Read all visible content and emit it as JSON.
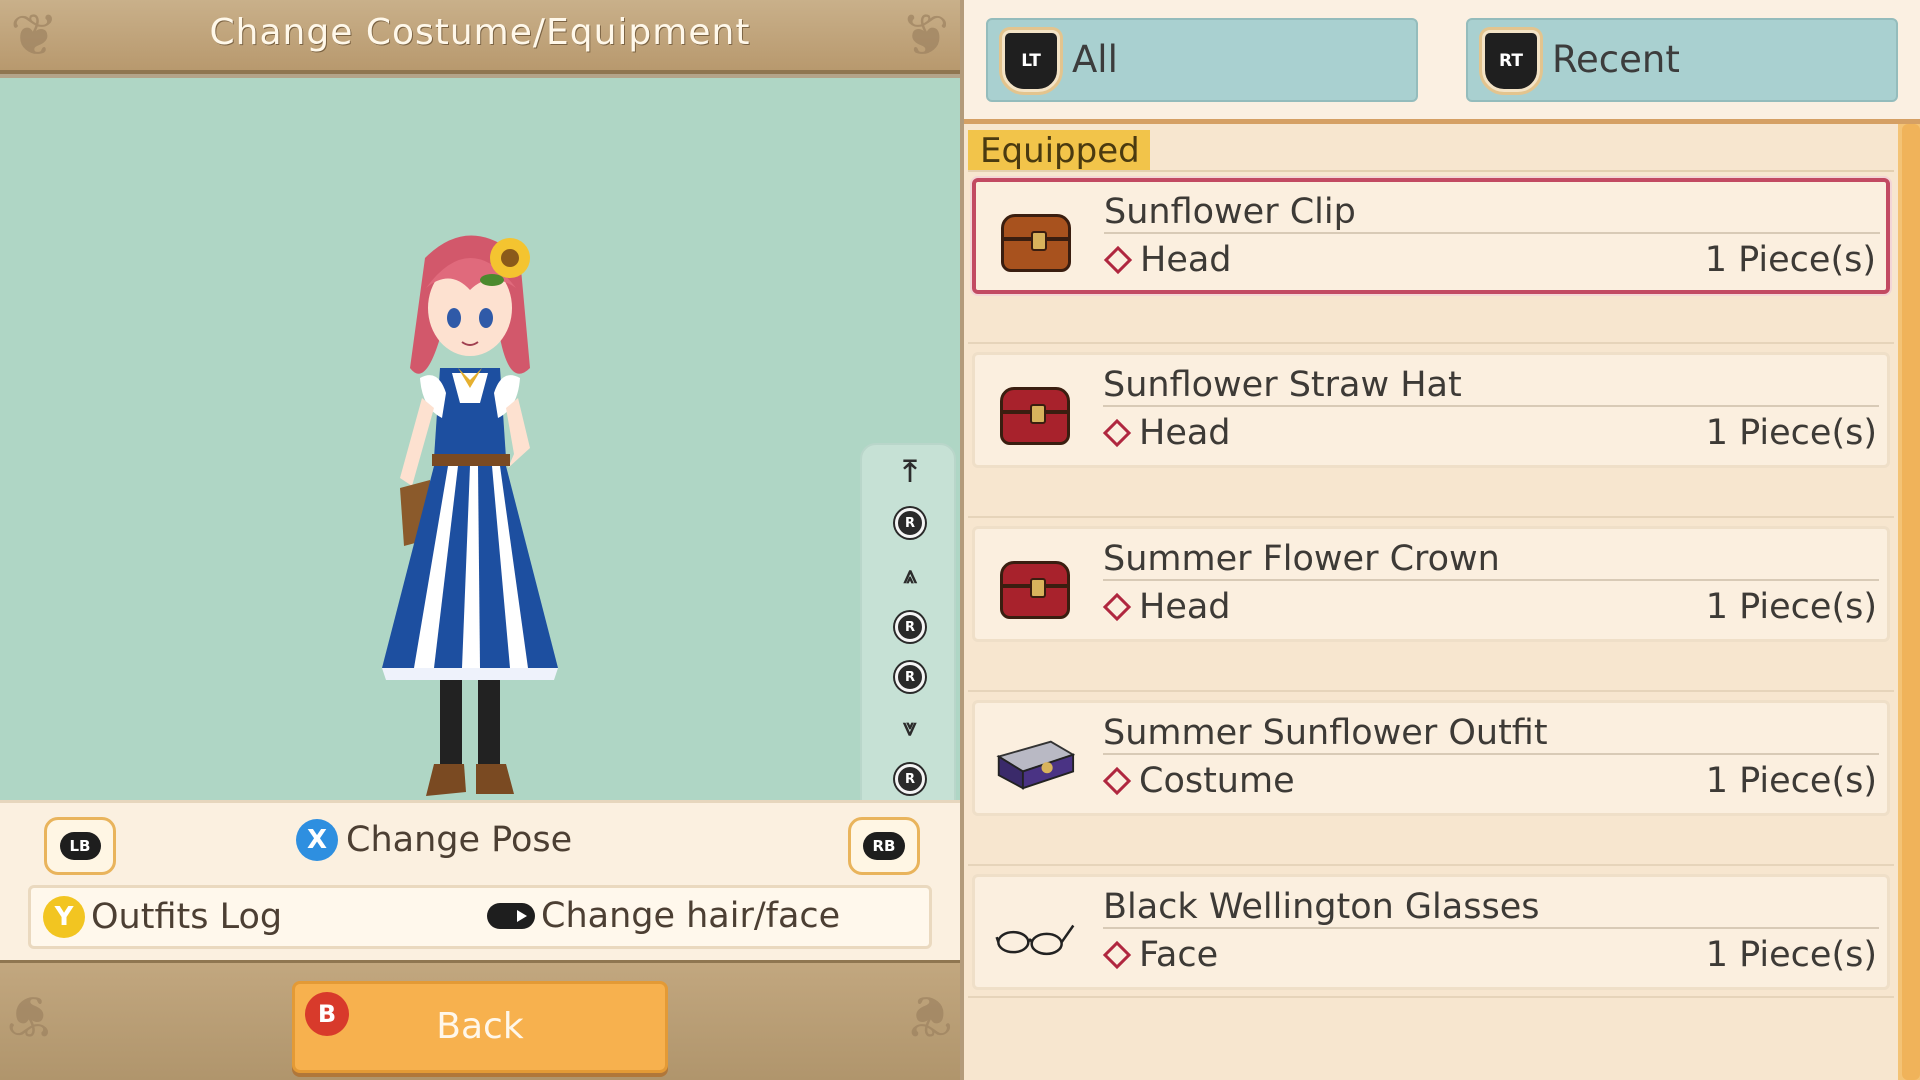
{
  "header": {
    "title": "Change Costume/Equipment"
  },
  "pose_controls": {
    "lb": "LB",
    "rb": "RB",
    "x_button": "X",
    "change_pose_label": "Change Pose",
    "r_stick": "R"
  },
  "sub_controls": {
    "y_button": "Y",
    "outfits_log_label": "Outfits Log",
    "change_hair_label": "Change hair/face"
  },
  "footer": {
    "b_button": "B",
    "back_label": "Back"
  },
  "tabs": [
    {
      "trigger": "LT",
      "label": "All"
    },
    {
      "trigger": "RT",
      "label": "Recent"
    }
  ],
  "list": {
    "section_label": "Equipped",
    "items": [
      {
        "name": "Sunflower Clip",
        "slot": "Head",
        "qty": "1 Piece(s)",
        "icon": "brown-chest-icon",
        "selected": true
      },
      {
        "name": "Sunflower Straw Hat",
        "slot": "Head",
        "qty": "1 Piece(s)",
        "icon": "red-chest-icon"
      },
      {
        "name": "Summer Flower Crown",
        "slot": "Head",
        "qty": "1 Piece(s)",
        "icon": "red-chest-icon"
      },
      {
        "name": "Summer Sunflower Outfit",
        "slot": "Costume",
        "qty": "1 Piece(s)",
        "icon": "purple-case-icon"
      },
      {
        "name": "Black Wellington Glasses",
        "slot": "Face",
        "qty": "1 Piece(s)",
        "icon": "glasses-icon"
      }
    ]
  },
  "colors": {
    "viewer_bg": "#afd6c5",
    "tab_bg": "#a9d0d0",
    "accent": "#f7b14e",
    "selection": "#c24a62",
    "equipped_tag": "#f2c44a"
  }
}
